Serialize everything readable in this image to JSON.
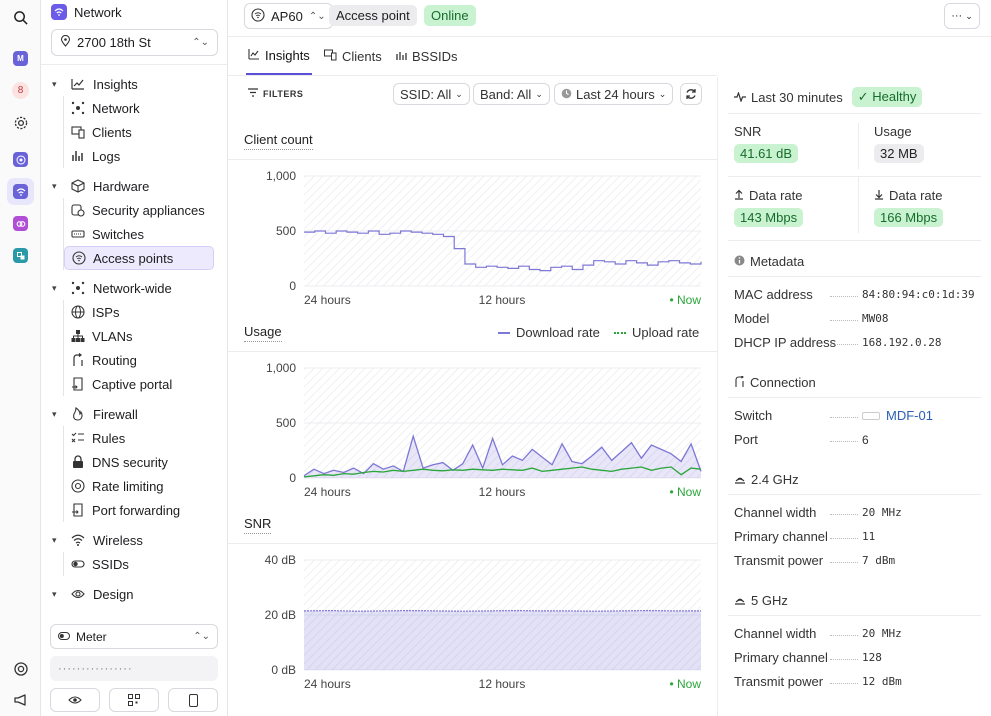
{
  "sidebar": {
    "network_label": "Network",
    "location": "2700 18th St",
    "groups": [
      {
        "label": "Insights",
        "items": [
          "Network",
          "Clients",
          "Logs"
        ]
      },
      {
        "label": "Hardware",
        "items": [
          "Security appliances",
          "Switches",
          "Access points"
        ]
      },
      {
        "label": "Network-wide",
        "items": [
          "ISPs",
          "VLANs",
          "Routing",
          "Captive portal"
        ]
      },
      {
        "label": "Firewall",
        "items": [
          "Rules",
          "DNS security",
          "Rate limiting",
          "Port forwarding"
        ]
      },
      {
        "label": "Wireless",
        "items": [
          "SSIDs"
        ]
      },
      {
        "label": "Design",
        "items": []
      }
    ],
    "company_select": "Meter",
    "dots": "················"
  },
  "rail": {
    "m_label": "M",
    "badge_label": "8"
  },
  "topbar": {
    "device": "AP60",
    "type_chip": "Access point",
    "status_chip": "Online",
    "more": "···"
  },
  "tabs": [
    "Insights",
    "Clients",
    "BSSIDs"
  ],
  "filters": {
    "label": "FILTERS",
    "ssid": "SSID: All",
    "band": "Band: All",
    "range": "Last 24 hours"
  },
  "charts": {
    "client_count_title": "Client count",
    "usage_title": "Usage",
    "snr_title": "SNR",
    "download_legend": "Download rate",
    "upload_legend": "Upload rate",
    "x_start": "24 hours",
    "x_mid": "12 hours",
    "x_now": "Now"
  },
  "chart_data": [
    {
      "type": "line",
      "title": "Client count",
      "y_ticks": [
        "1,000",
        "500",
        "0"
      ],
      "ylim": [
        0,
        1000
      ],
      "x_ticks": [
        "24 hours",
        "12 hours",
        "Now"
      ],
      "series": [
        {
          "values": [
            490,
            500,
            480,
            500,
            490,
            480,
            500,
            470,
            480,
            500,
            490,
            480,
            470,
            450,
            340,
            200,
            170,
            180,
            170,
            160,
            180,
            150,
            140,
            170,
            180,
            150,
            190,
            230,
            220,
            200,
            230,
            210,
            190,
            220,
            230,
            210,
            200,
            220
          ]
        }
      ]
    },
    {
      "type": "area",
      "title": "Usage",
      "y_ticks": [
        "1,000",
        "500",
        "0"
      ],
      "ylim": [
        0,
        1000
      ],
      "x_ticks": [
        "24 hours",
        "12 hours",
        "Now"
      ],
      "series": [
        {
          "name": "Download rate",
          "values": [
            20,
            80,
            40,
            70,
            50,
            90,
            40,
            130,
            80,
            110,
            60,
            380,
            90,
            120,
            140,
            70,
            130,
            300,
            90,
            360,
            120,
            200,
            160,
            260,
            190,
            120,
            310,
            150,
            130,
            200,
            280,
            160,
            240,
            320,
            180,
            300,
            260,
            220,
            150,
            310,
            60
          ]
        },
        {
          "name": "Upload rate",
          "values": [
            10,
            20,
            30,
            25,
            40,
            35,
            50,
            60,
            55,
            70,
            60,
            70,
            80,
            70,
            65,
            75,
            70,
            80,
            75,
            70,
            80,
            75,
            70,
            90,
            60,
            70,
            80,
            90,
            100,
            80,
            70,
            60,
            80,
            90,
            100,
            70,
            90,
            100,
            30,
            90,
            80
          ]
        }
      ]
    },
    {
      "type": "area",
      "title": "SNR",
      "y_ticks": [
        "40 dB",
        "20 dB",
        "0 dB"
      ],
      "ylim": [
        0,
        40
      ],
      "x_ticks": [
        "24 hours",
        "12 hours",
        "Now"
      ],
      "series": [
        {
          "values": [
            21.5,
            21.6,
            21.4,
            21.5,
            21.6,
            21.5,
            21.4,
            21.5,
            21.6,
            21.5,
            21.5,
            21.4,
            21.5,
            21.6,
            21.5,
            21.5
          ]
        }
      ]
    }
  ],
  "right": {
    "last_30": "Last 30 minutes",
    "healthy": "Healthy",
    "snr_label": "SNR",
    "snr_value": "41.61 dB",
    "usage_label": "Usage",
    "usage_value": "32 MB",
    "up_label": "Data rate",
    "up_value": "143 Mbps",
    "down_label": "Data rate",
    "down_value": "166 Mbps",
    "metadata_title": "Metadata",
    "metadata": [
      {
        "key": "MAC address",
        "value": "84:80:94:c0:1d:39"
      },
      {
        "key": "Model",
        "value": "MW08"
      },
      {
        "key": "DHCP IP address",
        "value": "168.192.0.28"
      }
    ],
    "connection_title": "Connection",
    "switch_key": "Switch",
    "switch_value": "MDF-01",
    "port_key": "Port",
    "port_value": "6",
    "band24_title": "2.4 GHz",
    "band24": [
      {
        "key": "Channel width",
        "value": "20 MHz"
      },
      {
        "key": "Primary channel",
        "value": "11"
      },
      {
        "key": "Transmit power",
        "value": "7 dBm"
      }
    ],
    "band5_title": "5 GHz",
    "band5": [
      {
        "key": "Channel width",
        "value": "20 MHz"
      },
      {
        "key": "Primary channel",
        "value": "128"
      },
      {
        "key": "Transmit power",
        "value": "12 dBm"
      }
    ]
  },
  "colors": {
    "accent": "#5a4fd6",
    "line": "#7d77d6",
    "upload": "#2aa63a",
    "now": "#2aa63a",
    "healthy_bg": "#c9f3d0"
  }
}
